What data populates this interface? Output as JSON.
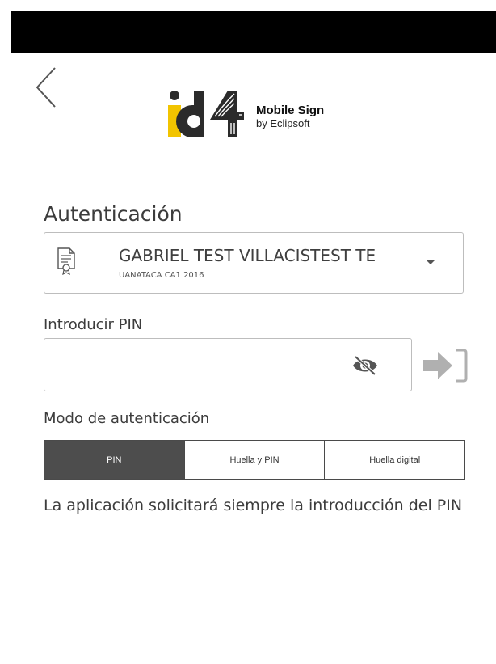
{
  "app": {
    "brand_title": "Mobile Sign",
    "brand_subtitle": "by Eclipsoft",
    "logo_text": "id4"
  },
  "auth": {
    "title": "Autenticación",
    "certificate": {
      "name": "GABRIEL TEST VILLACISTEST TE",
      "issuer": "UANATACA CA1 2016"
    },
    "pin_label": "Introducir PIN",
    "pin_value": "",
    "mode_label": "Modo de autenticación",
    "modes": [
      "PIN",
      "Huella y PIN",
      "Huella digital"
    ],
    "selected_mode": "PIN",
    "mode_description": "La aplicación solicitará siempre la introducción del PIN"
  },
  "icons": {
    "back": "chevron-left-icon",
    "certificate": "certificate-icon",
    "dropdown": "dropdown-arrow-icon",
    "visibility": "eye-slash-icon",
    "login": "login-arrow-icon"
  },
  "colors": {
    "logo_yellow": "#f2c400",
    "logo_dark": "#2b2b2b",
    "active_tab": "#4d4d4d",
    "icon_gray": "#b0b0b0"
  }
}
